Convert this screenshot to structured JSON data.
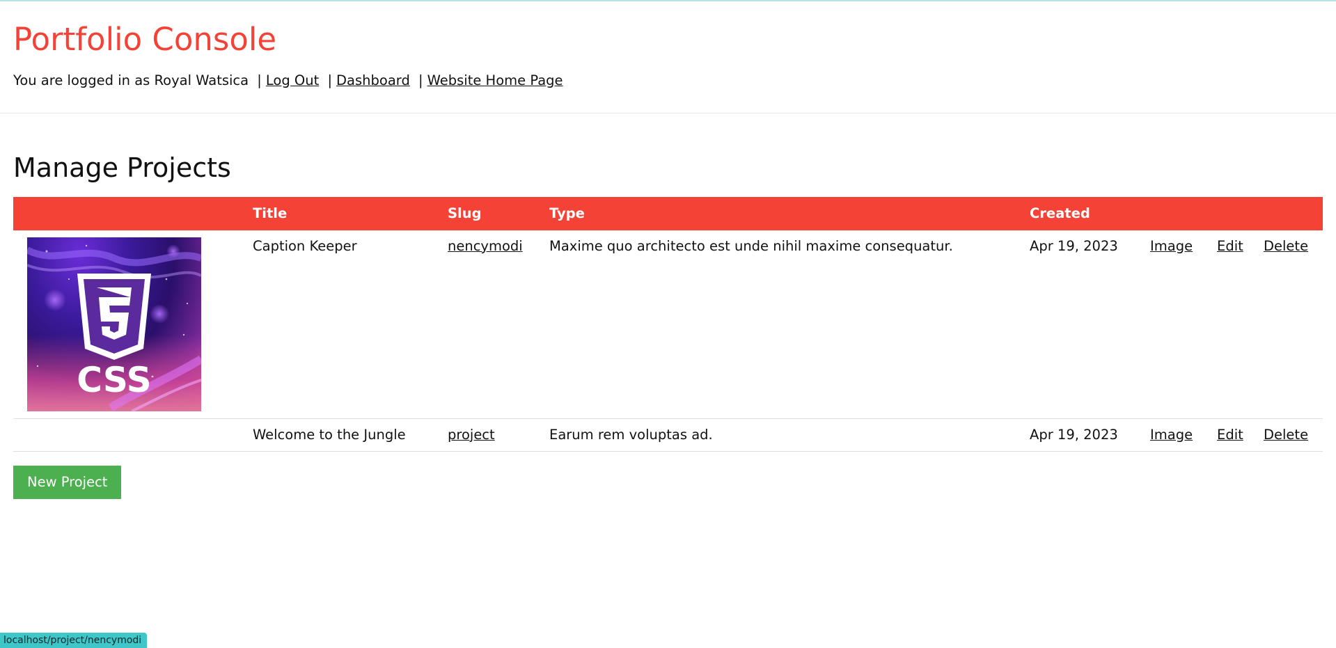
{
  "header": {
    "title": "Portfolio Console",
    "login_prefix": "You are logged in as Royal Watsica",
    "separator": "|",
    "links": {
      "logout": "Log Out",
      "dashboard": "Dashboard",
      "home": "Website Home Page"
    }
  },
  "main": {
    "heading": "Manage Projects",
    "table": {
      "columns": [
        "",
        "Title",
        "Slug",
        "Type",
        "Created",
        "",
        "",
        ""
      ],
      "rows": [
        {
          "thumbnail": "css3-logo-image",
          "thumbnail_text": "CSS",
          "title": "Caption Keeper",
          "slug": "nencymodi",
          "type": "Maxime quo architecto est unde nihil maxime consequatur.",
          "created": "Apr 19, 2023",
          "image_link": "Image",
          "edit_link": "Edit",
          "delete_link": "Delete"
        },
        {
          "thumbnail": "",
          "title": "Welcome to the Jungle",
          "slug": "project",
          "type": "Earum rem voluptas ad.",
          "created": "Apr 19, 2023",
          "image_link": "Image",
          "edit_link": "Edit",
          "delete_link": "Delete"
        }
      ]
    },
    "new_button": "New Project"
  },
  "status_bar": {
    "url": "localhost/project/nencymodi"
  },
  "colors": {
    "accent": "#f44336",
    "button": "#4caf50",
    "status_bar": "#3ec6c9"
  }
}
